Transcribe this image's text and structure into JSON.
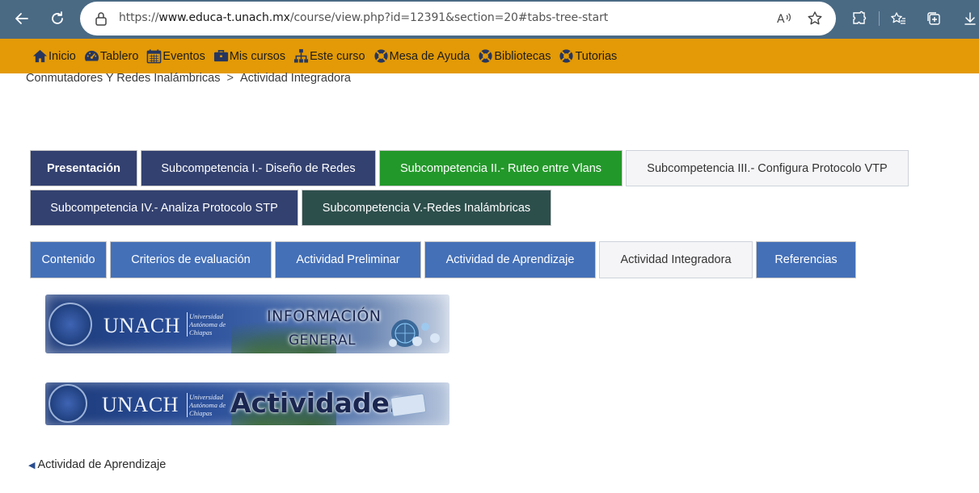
{
  "browser": {
    "url_prefix": "https://",
    "url_domain": "www.educa-t.unach.mx",
    "url_path": "/course/view.php?id=12391&section=20#tabs-tree-start",
    "read_aloud_label": "Aʼ"
  },
  "colors": {
    "browser_bar": "#4a6a84",
    "navbar": "#e39a06",
    "tab_navy": "#334170",
    "tab_green": "#23982a",
    "tab_teal": "#2d4f4c",
    "tab_blue": "#4470b8",
    "tab_active": "#f5f5f7"
  },
  "navbar": {
    "items": [
      {
        "label": "Inicio",
        "icon": "home-icon"
      },
      {
        "label": "Tablero",
        "icon": "dashboard-icon"
      },
      {
        "label": "Eventos",
        "icon": "calendar-icon"
      },
      {
        "label": "Mis cursos",
        "icon": "briefcase-icon"
      },
      {
        "label": "Este curso",
        "icon": "sitemap-icon"
      },
      {
        "label": "Mesa de Ayuda",
        "icon": "lifebuoy-icon"
      },
      {
        "label": "Bibliotecas",
        "icon": "lifebuoy-icon"
      },
      {
        "label": "Tutorias",
        "icon": "lifebuoy-icon"
      }
    ]
  },
  "breadcrumb": {
    "course": "Conmutadores Y Redes Inalámbricas",
    "separator": ">",
    "current": "Actividad Integradora"
  },
  "section_tabs": [
    {
      "label": "Presentación"
    },
    {
      "label": "Subcompetencia I.- Diseño de Redes"
    },
    {
      "label": "Subcompetencia II.- Ruteo entre Vlans"
    },
    {
      "label": "Subcompetencia III.- Configura Protocolo VTP",
      "active": true
    },
    {
      "label": "Subcompetencia IV.- Analiza Protocolo STP"
    },
    {
      "label": "Subcompetencia V.-Redes Inalámbricas"
    }
  ],
  "sub_tabs": [
    {
      "label": "Contenido"
    },
    {
      "label": "Criterios de evaluación"
    },
    {
      "label": "Actividad Preliminar"
    },
    {
      "label": "Actividad de Aprendizaje"
    },
    {
      "label": "Actividad Integradora",
      "active": true
    },
    {
      "label": "Referencias"
    }
  ],
  "banners": {
    "info": {
      "brand": "UNACH",
      "university": "Universidad Autónoma de Chiapas",
      "line1": "INFORMACIÓN",
      "line2": "GENERAL"
    },
    "activities": {
      "brand": "UNACH",
      "university": "Universidad Autónoma de Chiapas",
      "title": "Actividades"
    }
  },
  "prev_link": {
    "arrow": "◀",
    "label": "Actividad de Aprendizaje"
  }
}
